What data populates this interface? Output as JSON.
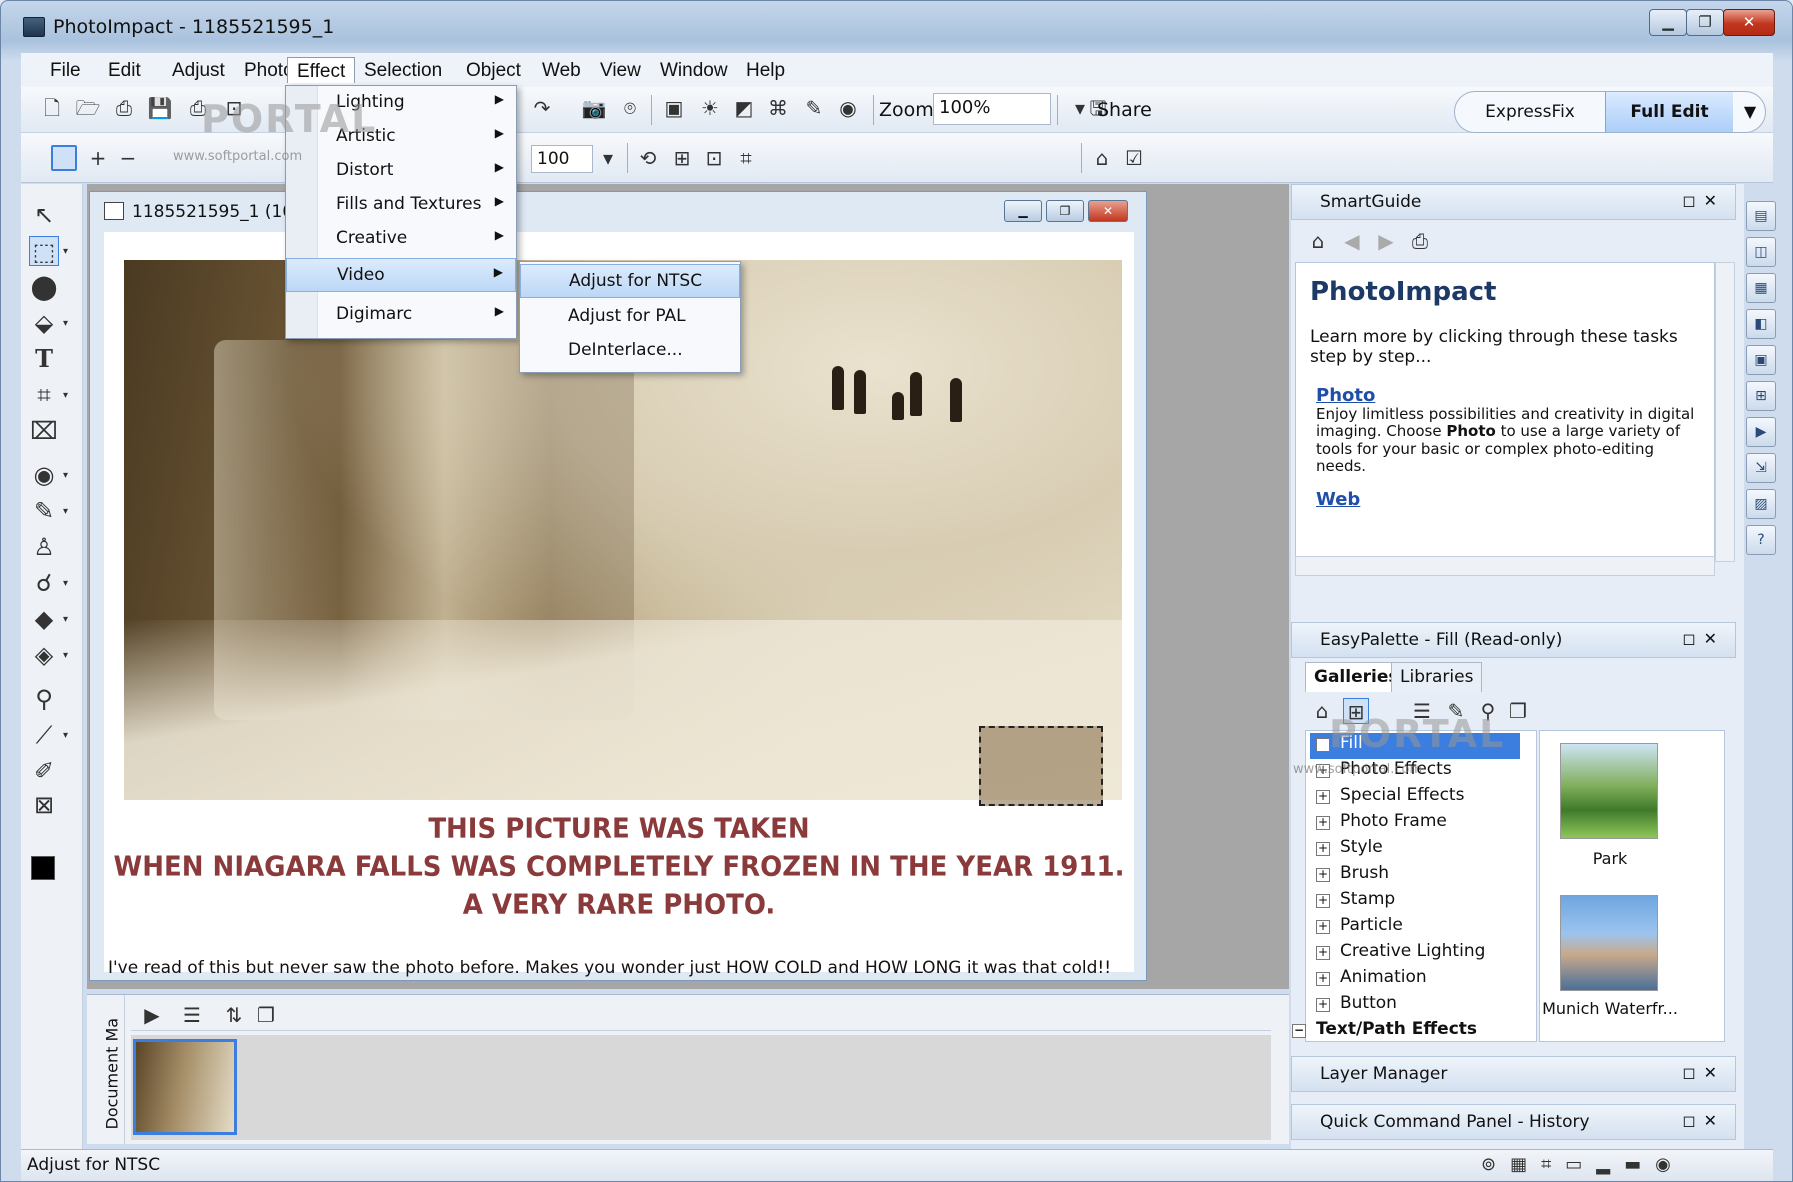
{
  "window": {
    "title": "PhotoImpact - 1185521595_1",
    "min_label": "▁",
    "max_label": "❐",
    "close_label": "✕"
  },
  "menubar": [
    "File",
    "Edit",
    "Adjust",
    "Photo",
    "Effect",
    "Selection",
    "Object",
    "Web",
    "View",
    "Window",
    "Help"
  ],
  "toolbar": {
    "zoom_label": "Zoom",
    "zoom_value": "100%",
    "share_label": "Share",
    "mode_express": "ExpressFix",
    "mode_full": "Full Edit",
    "value_field": "100"
  },
  "effect_menu": {
    "items": [
      "Lighting",
      "Artistic",
      "Distort",
      "Fills and Textures",
      "Creative",
      "Video",
      "Digimarc"
    ],
    "highlighted": "Video"
  },
  "video_submenu": {
    "items": [
      "Adjust for NTSC",
      "Adjust for PAL",
      "DeInterlace..."
    ],
    "highlighted": "Adjust for NTSC"
  },
  "watermark": {
    "text": "PORTAL",
    "url": "www.softportal.com"
  },
  "document": {
    "title": "1185521595_1 (100%",
    "caption_line1": "THIS PICTURE WAS TAKEN",
    "caption_line2": "WHEN NIAGARA FALLS WAS COMPLETELY FROZEN IN THE YEAR 1911.",
    "caption_line3": "A VERY RARE PHOTO.",
    "note": "I've read of this but never saw the photo before.  Makes you wonder just HOW COLD and HOW LONG it was that cold!!"
  },
  "smartguide": {
    "panel_title": "SmartGuide",
    "heading": "PhotoImpact",
    "intro": "Learn more by clicking through these tasks step by step...",
    "photo_link": "Photo",
    "photo_desc_1": "Enjoy limitless possibilities and creativity in digital imaging. Choose ",
    "photo_desc_bold": "Photo",
    "photo_desc_2": " to use a large variety of tools for your basic or complex photo-editing needs.",
    "web_link": "Web"
  },
  "easypalette": {
    "panel_title": "EasyPalette - Fill (Read-only)",
    "tabs": [
      "Galleries",
      "Libraries"
    ],
    "tree": [
      "Fill",
      "Photo Effects",
      "Special Effects",
      "Photo Frame",
      "Style",
      "Brush",
      "Stamp",
      "Particle",
      "Creative Lighting",
      "Animation",
      "Button",
      "Text/Path Effects"
    ],
    "selected": "Fill",
    "thumbs": [
      "Park",
      "Munich Waterfr..."
    ]
  },
  "layer_manager": {
    "panel_title": "Layer Manager"
  },
  "quick_command": {
    "panel_title": "Quick Command Panel - History"
  },
  "document_manager": {
    "label": "Document Ma"
  },
  "status": {
    "text": "Adjust for NTSC"
  },
  "colors": {
    "highlight": "#3b7ee0",
    "caption": "#8a3a3a",
    "link": "#1f4fa8"
  }
}
